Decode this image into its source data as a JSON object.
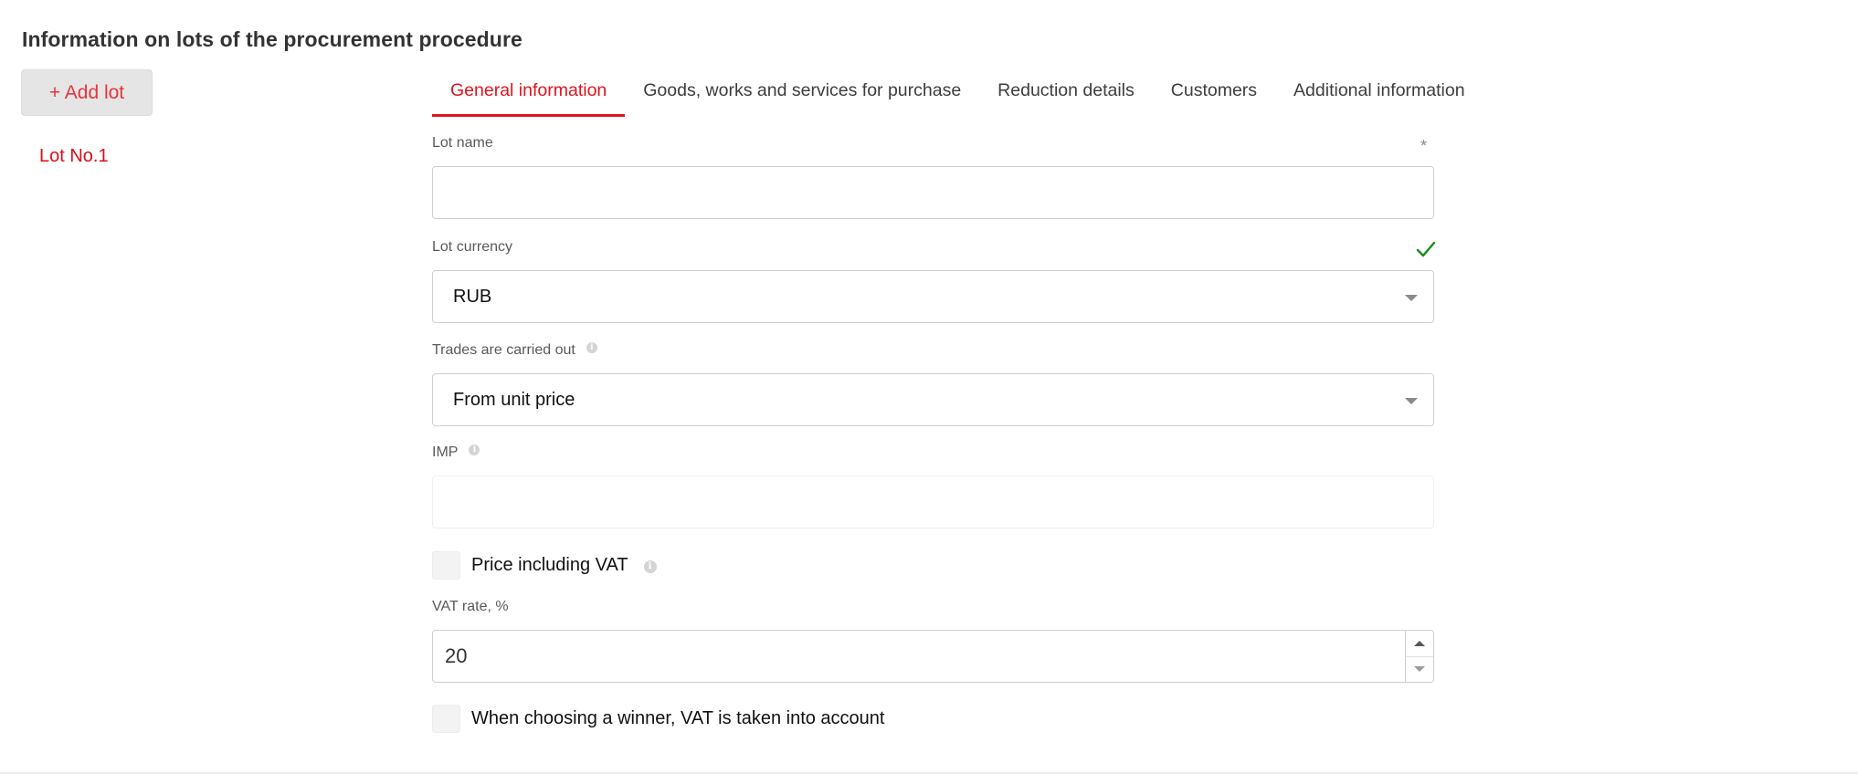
{
  "page": {
    "title": "Information on lots of the procurement procedure"
  },
  "lots": {
    "add_label": "+ Add lot",
    "items": [
      {
        "label": "Lot No.1"
      }
    ]
  },
  "tabs": [
    {
      "label": "General information",
      "active": true
    },
    {
      "label": "Goods, works and services for purchase",
      "active": false
    },
    {
      "label": "Reduction details",
      "active": false
    },
    {
      "label": "Customers",
      "active": false
    },
    {
      "label": "Additional information",
      "active": false
    }
  ],
  "form": {
    "lot_name": {
      "label": "Lot name",
      "required_mark": "*",
      "value": ""
    },
    "lot_currency": {
      "label": "Lot currency",
      "value": "RUB",
      "status_icon": "checkmark-icon"
    },
    "trades": {
      "label": "Trades are carried out",
      "value": "From unit price",
      "info_icon": "info-icon"
    },
    "imp": {
      "label": "IMP",
      "value": "",
      "info_icon": "info-icon"
    },
    "price_including_vat": {
      "label": "Price including VAT",
      "checked": false,
      "info_icon": "info-icon"
    },
    "vat_rate": {
      "label": "VAT rate, %",
      "value": "20"
    },
    "winner_vat": {
      "label": "When choosing a winner, VAT is taken into account",
      "checked": false
    }
  },
  "colors": {
    "accent": "#e0131e",
    "add_lot_text": "#e8343c",
    "check": "#1a8a1a",
    "border": "#cfcfcf"
  }
}
